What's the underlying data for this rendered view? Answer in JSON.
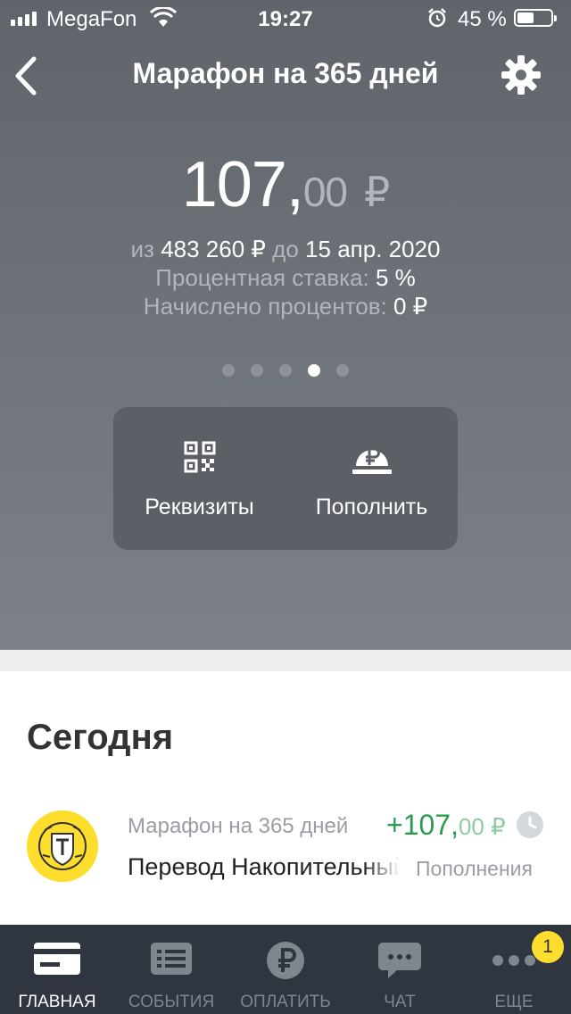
{
  "status_bar": {
    "carrier": "MegaFon",
    "time": "19:27",
    "battery": "45 %"
  },
  "header": {
    "title": "Марафон на 365 дней"
  },
  "balance": {
    "whole": "107,",
    "fraction": "00",
    "currency": "₽"
  },
  "details": {
    "of_prefix": "из",
    "goal": "483 260 ₽",
    "until_prefix": "до",
    "deadline": "15 апр. 2020",
    "rate_label": "Процентная ставка:",
    "rate_value": "5 %",
    "interest_label": "Начислено процентов:",
    "interest_value": "0 ₽"
  },
  "pager": {
    "count": 5,
    "active_index": 3
  },
  "actions": [
    {
      "label": "Реквизиты",
      "icon": "qr-code-icon"
    },
    {
      "label": "Пополнить",
      "icon": "ruble-coin-icon"
    }
  ],
  "feed": {
    "section_title": "Сегодня",
    "operations": [
      {
        "category": "Марафон на 365 дней",
        "name": "Перевод Накопительный счет",
        "amount_main": "+107,",
        "amount_fraction": "00 ₽",
        "type": "Пополнения",
        "icon": "tinkoff-logo-icon",
        "status_icon": "clock-icon"
      }
    ]
  },
  "tabbar": {
    "tabs": [
      {
        "label": "ГЛАВНАЯ",
        "icon": "card-icon",
        "active": true
      },
      {
        "label": "СОБЫТИЯ",
        "icon": "list-icon",
        "active": false
      },
      {
        "label": "ОПЛАТИТЬ",
        "icon": "ruble-icon",
        "active": false
      },
      {
        "label": "ЧАТ",
        "icon": "chat-icon",
        "active": false
      },
      {
        "label": "ЕЩЕ",
        "icon": "more-icon",
        "active": false
      }
    ],
    "more_badge": "1"
  },
  "colors": {
    "header_bg": "#6a6f76",
    "income_green": "#2c9b51",
    "brand_yellow": "#ffdd2d",
    "tabbar_bg": "#2f3640"
  }
}
